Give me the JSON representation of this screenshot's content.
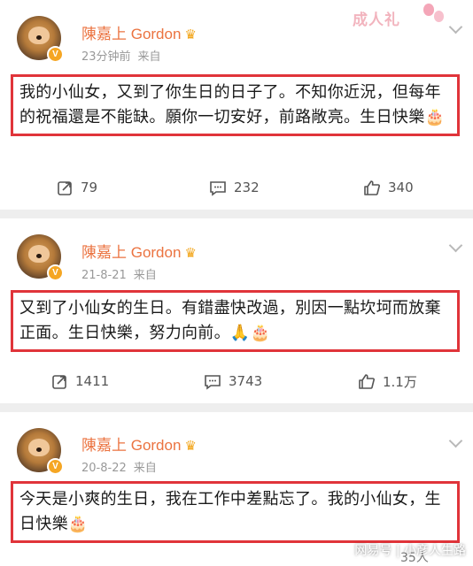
{
  "posts": [
    {
      "author": "陳嘉上 Gordon",
      "time": "23分钟前",
      "source": "来自",
      "text": "我的小仙女，又到了你生日的日子了。不知你近況，但每年的祝福還是不能缺。願你一切安好，前路敞亮。生日快樂🎂",
      "reposts": "79",
      "comments": "232",
      "likes": "340"
    },
    {
      "author": "陳嘉上 Gordon",
      "time": "21-8-21",
      "source": "来自",
      "text": "又到了小仙女的生日。有錯盡快改過，別因一點坎坷而放棄正面。生日快樂，努力向前。🙏🎂",
      "reposts": "1411",
      "comments": "3743",
      "likes": "1.1万"
    },
    {
      "author": "陳嘉上 Gordon",
      "time": "20-8-22",
      "source": "来自",
      "text": "今天是小爽的生日，我在工作中差點忘了。我的小仙女，生日快樂🎂"
    }
  ],
  "decor": {
    "tag": "成人礼",
    "watermark": "网易号 | 小彦人生路",
    "partial_count": "35人"
  },
  "colors": {
    "name": "#eb7340",
    "highlight_border": "#e0343a",
    "vip_badge": "#f5a623"
  },
  "icons": [
    "crown-icon",
    "repost-icon",
    "comment-icon",
    "like-icon",
    "chevron-down-icon"
  ]
}
